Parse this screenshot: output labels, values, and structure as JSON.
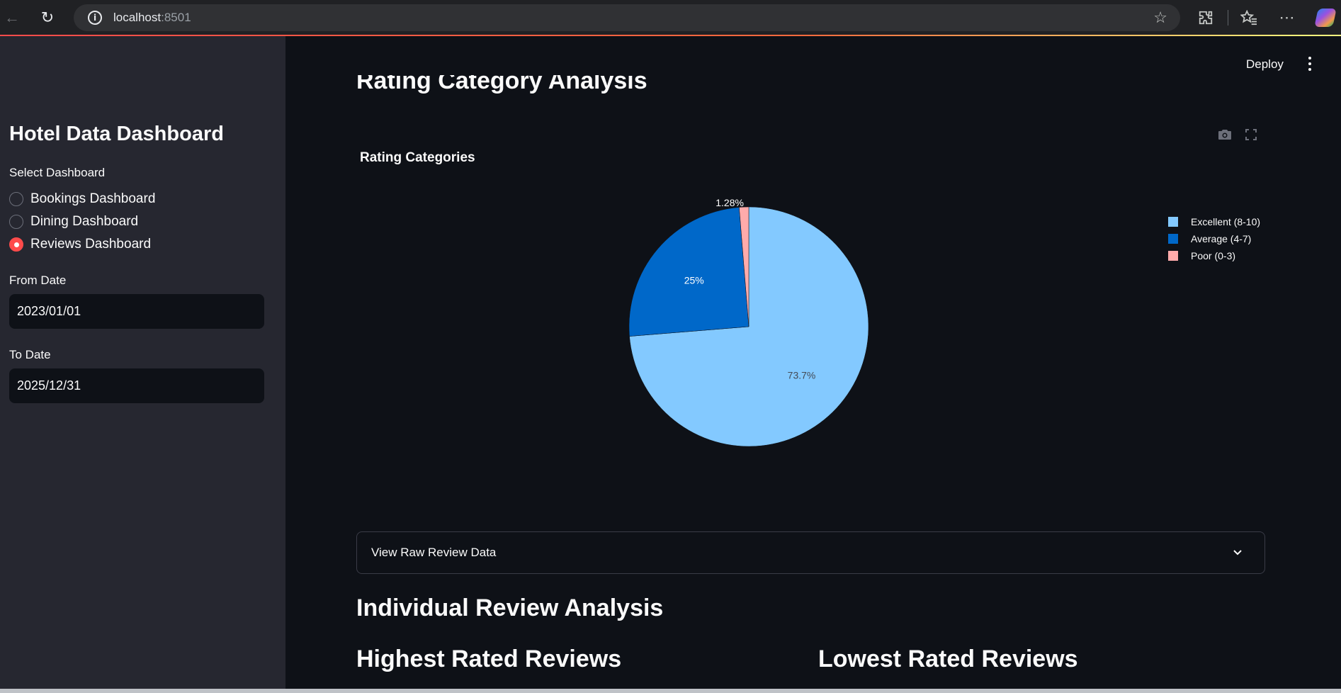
{
  "browser": {
    "url_host": "localhost",
    "url_port": ":8501"
  },
  "sidebar": {
    "title": "Hotel Data Dashboard",
    "select_label": "Select Dashboard",
    "options": [
      {
        "label": "Bookings Dashboard",
        "selected": false
      },
      {
        "label": "Dining Dashboard",
        "selected": false
      },
      {
        "label": "Reviews Dashboard",
        "selected": true
      }
    ],
    "from_date_label": "From Date",
    "from_date_value": "2023/01/01",
    "to_date_label": "To Date",
    "to_date_value": "2025/12/31"
  },
  "header": {
    "deploy_label": "Deploy"
  },
  "main": {
    "section_heading": "Rating Category Analysis",
    "expander_label": "View Raw Review Data",
    "individual_heading": "Individual Review Analysis",
    "highest_heading": "Highest Rated Reviews",
    "lowest_heading": "Lowest Rated Reviews"
  },
  "colors": {
    "accent": "#ff4b4b",
    "sidebar_bg": "#262730",
    "main_bg": "#0e1117"
  },
  "chart_data": {
    "type": "pie",
    "title": "Rating Categories",
    "categories": [
      "Excellent (8-10)",
      "Average (4-7)",
      "Poor (0-3)"
    ],
    "values": [
      73.7,
      25,
      1.28
    ],
    "labels": [
      "73.7%",
      "25%",
      "1.28%"
    ],
    "colors": [
      "#83c9ff",
      "#0068c9",
      "#ffabab"
    ],
    "legend_position": "top-right"
  }
}
